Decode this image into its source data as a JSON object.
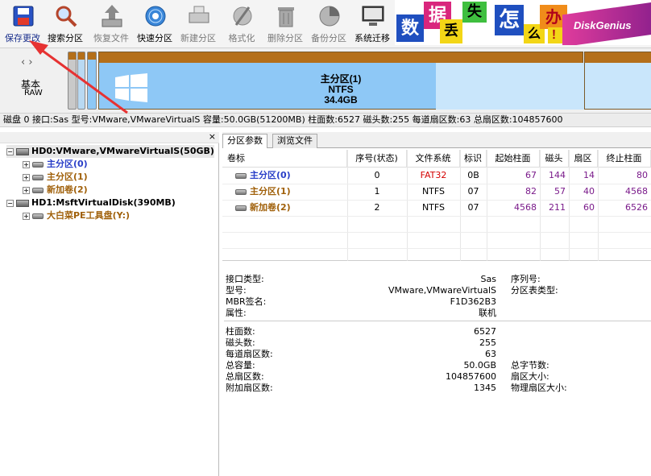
{
  "colors": {
    "toolbar_bg": "#f4f4f4",
    "partition_cap": "#b46f1a",
    "partition_fill": "#8ec8f6",
    "partition_free": "#c9e6fb",
    "label_blue": "#2a3fc8",
    "label_brown": "#a0600a",
    "number_purple": "#7a1a8a",
    "fat_red": "#d40000",
    "arrow_red": "#e63232"
  },
  "toolbar": {
    "items": [
      {
        "label": "保存更改",
        "icon": "save-disk-icon",
        "state": "active"
      },
      {
        "label": "搜索分区",
        "icon": "magnifier-icon",
        "state": "normal"
      },
      {
        "label": "恢复文件",
        "icon": "recover-files-icon",
        "state": "disabled"
      },
      {
        "label": "快速分区",
        "icon": "quick-partition-disc-icon",
        "state": "normal"
      },
      {
        "label": "新建分区",
        "icon": "new-partition-icon",
        "state": "disabled"
      },
      {
        "label": "格式化",
        "icon": "format-icon",
        "state": "disabled"
      },
      {
        "label": "删除分区",
        "icon": "trash-bin-icon",
        "state": "disabled"
      },
      {
        "label": "备份分区",
        "icon": "backup-icon",
        "state": "disabled"
      },
      {
        "label": "系统迁移",
        "icon": "system-migration-icon",
        "state": "normal"
      }
    ]
  },
  "banner": {
    "tiles": [
      "数",
      "据",
      "丢",
      "失",
      "怎",
      "么",
      "办",
      "！"
    ],
    "brand": "DiskGenius"
  },
  "diskmap": {
    "nav": "‹ ›",
    "disk_kind": "基本",
    "disk_format": "RAW",
    "partition_name": "主分区(1)",
    "partition_fs": "NTFS",
    "partition_size": "34.4GB"
  },
  "infobar": {
    "text": "磁盘 0 接口:Sas  型号:VMware,VMwareVirtualS  容量:50.0GB(51200MB)  柱面数:6527  磁头数:255  每道扇区数:63  总扇区数:104857600"
  },
  "tree": {
    "close": "×",
    "disks": [
      {
        "label": "HD0:VMware,VMwareVirtualS(50GB)",
        "expander": "−",
        "partitions": [
          {
            "label": "主分区(0)",
            "expander": "+",
            "color": "blue"
          },
          {
            "label": "主分区(1)",
            "expander": "+",
            "color": "brown"
          },
          {
            "label": "新加卷(2)",
            "expander": "+",
            "color": "brown"
          }
        ]
      },
      {
        "label": "HD1:MsftVirtualDisk(390MB)",
        "expander": "−",
        "partitions": [
          {
            "label": "大白菜PE工具盘(Y:)",
            "expander": "+",
            "color": "brown"
          }
        ]
      }
    ]
  },
  "tabs": [
    {
      "label": "分区参数",
      "active": true
    },
    {
      "label": "浏览文件",
      "active": false
    }
  ],
  "partition_table": {
    "columns": [
      "卷标",
      "序号(状态)",
      "文件系统",
      "标识",
      "起始柱面",
      "磁头",
      "扇区",
      "终止柱面"
    ],
    "rows": [
      {
        "name": "主分区(0)",
        "index": "0",
        "fs": "FAT32",
        "id": "0B",
        "start_cyl": "67",
        "head": "144",
        "sector": "14",
        "end_cyl": "80"
      },
      {
        "name": "主分区(1)",
        "index": "1",
        "fs": "NTFS",
        "id": "07",
        "start_cyl": "82",
        "head": "57",
        "sector": "40",
        "end_cyl": "4568"
      },
      {
        "name": "新加卷(2)",
        "index": "2",
        "fs": "NTFS",
        "id": "07",
        "start_cyl": "4568",
        "head": "211",
        "sector": "60",
        "end_cyl": "6526"
      }
    ]
  },
  "details": {
    "left": [
      {
        "label": "接口类型:",
        "value": "Sas"
      },
      {
        "label": "型号:",
        "value": "VMware,VMwareVirtualS"
      },
      {
        "label": "MBR签名:",
        "value": "F1D362B3"
      },
      {
        "label": "属性:",
        "value": "联机"
      }
    ],
    "right": [
      {
        "label": "序列号:"
      },
      {
        "label": "分区表类型:"
      }
    ],
    "geo": [
      {
        "label": "柱面数:",
        "value": "6527"
      },
      {
        "label": "磁头数:",
        "value": "255"
      },
      {
        "label": "每道扇区数:",
        "value": "63"
      },
      {
        "label": "总容量:",
        "value": "50.0GB"
      },
      {
        "label": "总扇区数:",
        "value": "104857600"
      },
      {
        "label": "附加扇区数:",
        "value": "1345"
      }
    ],
    "geo_right": [
      {
        "label": "总字节数:"
      },
      {
        "label": "扇区大小:"
      },
      {
        "label": "物理扇区大小:"
      }
    ]
  }
}
